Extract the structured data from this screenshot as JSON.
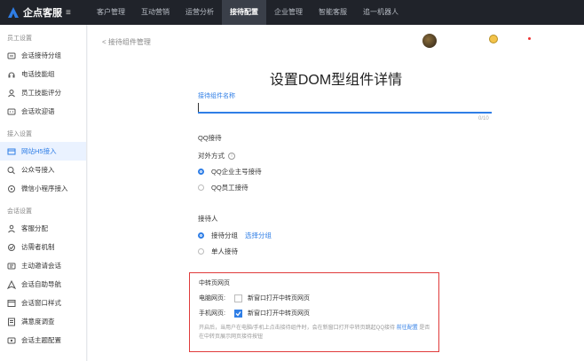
{
  "app": {
    "name": "企点客服"
  },
  "nav": {
    "items": [
      {
        "label": "客户管理",
        "active": false
      },
      {
        "label": "互动营销",
        "active": false
      },
      {
        "label": "运营分析",
        "active": false
      },
      {
        "label": "接待配置",
        "active": true
      },
      {
        "label": "企业管理",
        "active": false
      },
      {
        "label": "智能客服",
        "active": false
      },
      {
        "label": "追一机器人",
        "active": false
      }
    ]
  },
  "sidebar": {
    "groups": [
      {
        "title": "员工设置",
        "items": [
          {
            "label": "会话接待分组",
            "icon": "chat-group-icon"
          },
          {
            "label": "电话技能组",
            "icon": "headset-icon"
          },
          {
            "label": "员工技能评分",
            "icon": "user-rating-icon"
          },
          {
            "label": "会话欢迎语",
            "icon": "welcome-chat-icon"
          }
        ]
      },
      {
        "title": "接入设置",
        "items": [
          {
            "label": "网站H5接入",
            "icon": "web-icon",
            "active": true
          },
          {
            "label": "公众号接入",
            "icon": "wechat-official-icon"
          },
          {
            "label": "微信小程序接入",
            "icon": "mini-program-icon"
          }
        ]
      },
      {
        "title": "会话设置",
        "items": [
          {
            "label": "客服分配",
            "icon": "assign-icon"
          },
          {
            "label": "访需者机制",
            "icon": "visitor-icon"
          },
          {
            "label": "主动邀请会话",
            "icon": "invite-icon"
          },
          {
            "label": "会话自助导航",
            "icon": "navigation-icon"
          },
          {
            "label": "会话窗口样式",
            "icon": "window-style-icon"
          },
          {
            "label": "满意度调查",
            "icon": "survey-icon"
          },
          {
            "label": "会话主题配置",
            "icon": "theme-icon"
          }
        ]
      }
    ]
  },
  "main": {
    "back_label": "< 接待组件管理",
    "title": "设置DOM型组件详情",
    "name_field": {
      "label": "接待组件名称",
      "value": "",
      "counter": "0/10"
    },
    "qq": {
      "section_title": "QQ接待",
      "mode_label": "对外方式",
      "options": [
        {
          "label": "QQ企业主号接待",
          "selected": true
        },
        {
          "label": "QQ员工接待",
          "selected": false
        }
      ]
    },
    "receiver": {
      "section_title": "接待人",
      "options": [
        {
          "label": "接待分组",
          "selected": true,
          "link": "选择分组"
        },
        {
          "label": "单人接待",
          "selected": false
        }
      ]
    },
    "redirect": {
      "title": "中转页网页",
      "pc": {
        "label": "电脑网页:",
        "checkbox_label": "新窗口打开中转页网页",
        "checked": false
      },
      "mobile": {
        "label": "手机网页:",
        "checkbox_label": "新窗口打开中转页网页",
        "checked": true
      },
      "note": "开启后，当用户在电脑/手机上点击接待组件时，会在新窗口打开中转页跳起QQ接待",
      "note_link": "前往配置",
      "note_tail": "是否在中转页展示网页接待按钮"
    }
  },
  "colors": {
    "accent": "#2f7ee6",
    "highlight_border": "#e03b3b",
    "topbar": "#20232a"
  }
}
